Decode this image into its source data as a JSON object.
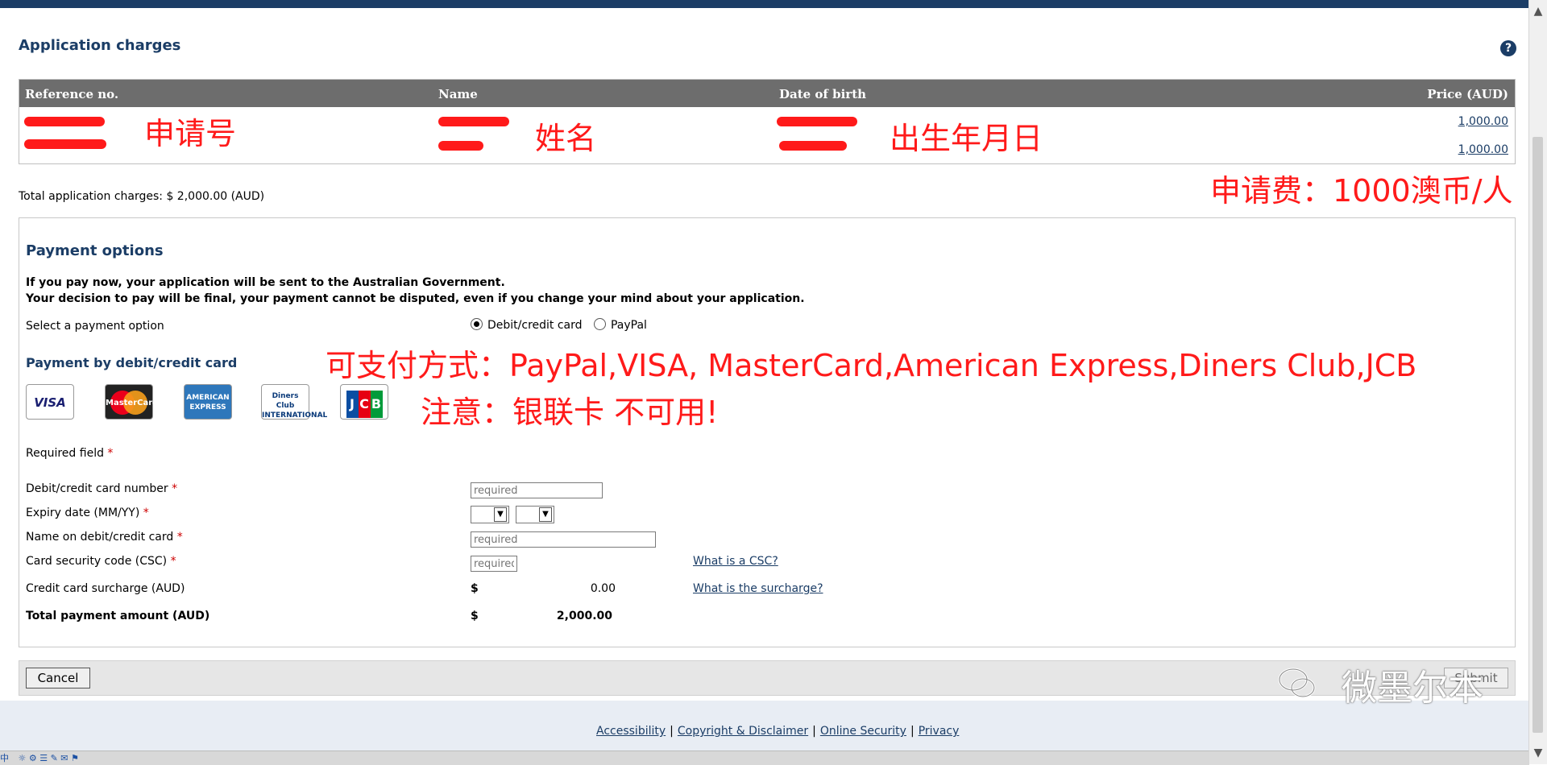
{
  "charges": {
    "title": "Application charges",
    "help": "?",
    "columns": [
      "Reference no.",
      "Name",
      "Date of birth",
      "Price (AUD)"
    ],
    "rows": [
      {
        "price": "1,000.00"
      },
      {
        "price": "1,000.00"
      }
    ],
    "total": "Total application charges: $ 2,000.00 (AUD)"
  },
  "annotations": {
    "ref": "申请号",
    "name": "姓名",
    "dob": "出生年月日",
    "fee": "申请费：1000澳币/人",
    "methods": "可支付方式：PayPal,VISA, MasterCard,American Express,Diners Club,JCB",
    "note": "注意：银联卡 不可用!"
  },
  "payment": {
    "title": "Payment options",
    "notice1": "If you pay now, your application will be sent to the Australian Government.",
    "notice2": "Your decision to pay will be final, your payment cannot be disputed, even if you change your mind about your application.",
    "select_label": "Select a payment option",
    "option_card": "Debit/credit card",
    "option_paypal": "PayPal",
    "card_section_title": "Payment by debit/credit card",
    "cards": {
      "visa": "VISA",
      "mastercard": "MasterCard",
      "amex": "AMERICAN EXPRESS",
      "diners": "Diners Club INTERNATIONAL",
      "jcb": "JCB"
    },
    "required_field": "Required field",
    "required_mark": "*",
    "card_number_label": "Debit/credit card number",
    "card_number_placeholder": "required",
    "expiry_label": "Expiry date (MM/YY)",
    "name_label": "Name on debit/credit card",
    "name_placeholder": "required",
    "csc_label": "Card security code (CSC)",
    "csc_placeholder": "required",
    "csc_help": "What is a CSC?",
    "surcharge_label": "Credit card surcharge (AUD)",
    "surcharge_currency": "$",
    "surcharge_value": "0.00",
    "surcharge_help": "What is the surcharge?",
    "total_label": "Total payment amount (AUD)",
    "total_currency": "$",
    "total_value": "2,000.00"
  },
  "actions": {
    "cancel": "Cancel",
    "submit": "Submit"
  },
  "footer": {
    "links": [
      "Accessibility",
      "Copyright & Disclaimer",
      "Online Security",
      "Privacy"
    ],
    "separator": "|"
  },
  "watermark": "微墨尔本",
  "taskbar": {
    "ime": "中"
  },
  "colors": {
    "brand": "#1b3d66",
    "annotation": "#ff1a1a",
    "header": "#6d6d6d"
  }
}
